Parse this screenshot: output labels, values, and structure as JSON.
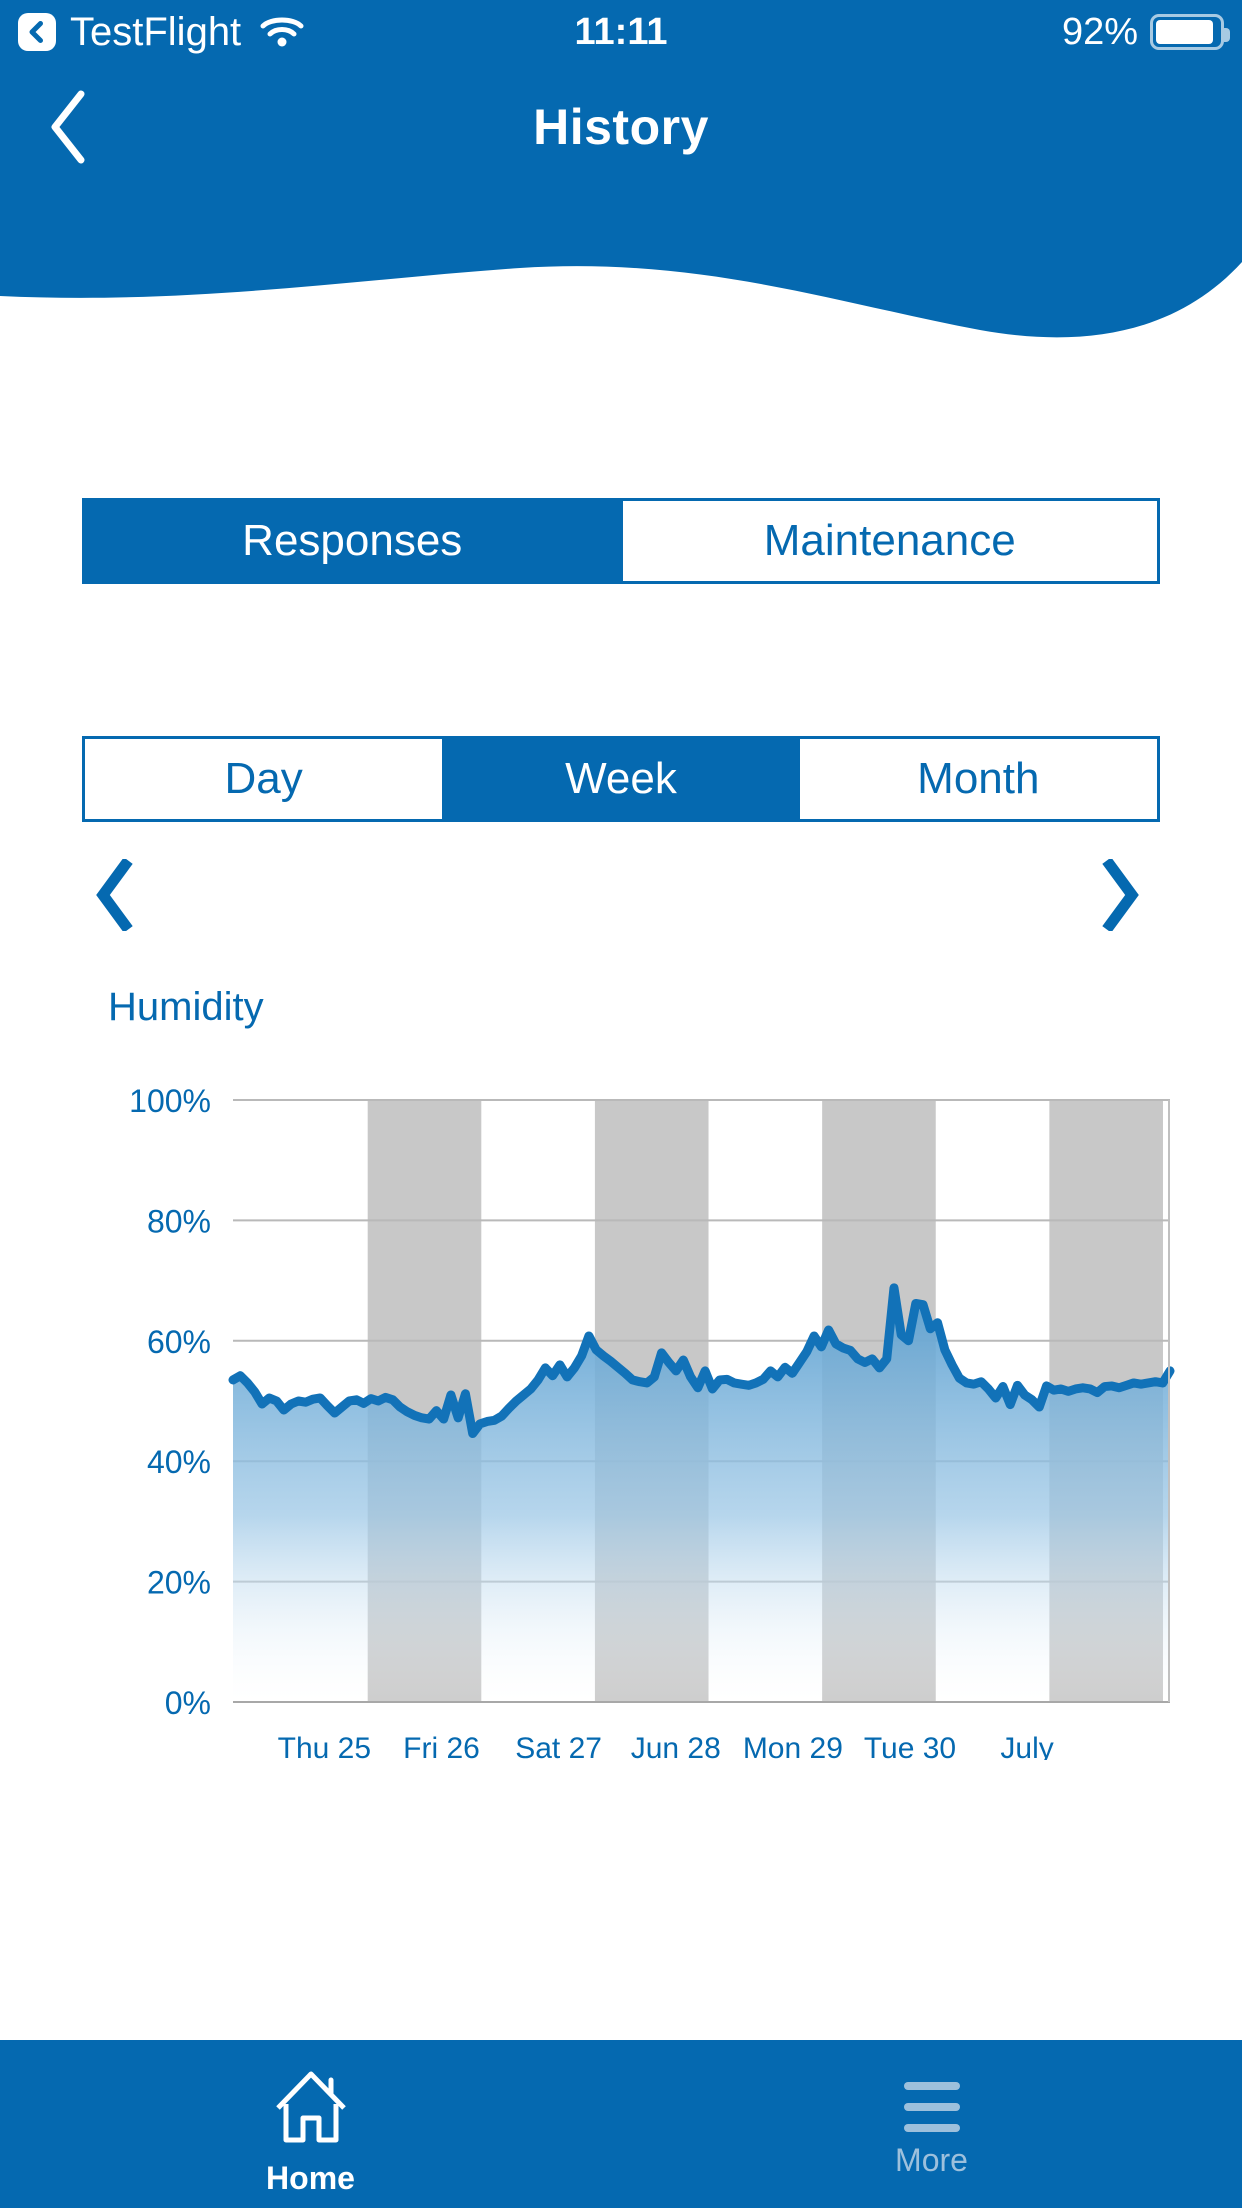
{
  "status_bar": {
    "back_badge_icon": "back-chevron-badge-icon",
    "carrier": "TestFlight",
    "wifi_icon": "wifi-icon",
    "time": "11:11",
    "battery_percent": "92%",
    "battery_level": 92,
    "battery_icon": "battery-icon"
  },
  "nav": {
    "back_icon": "chevron-left-icon",
    "title": "History"
  },
  "source_tabs": {
    "name": "responses-maintenance-segmented-control",
    "items": [
      {
        "label": "Responses",
        "active": true
      },
      {
        "label": "Maintenance",
        "active": false
      }
    ]
  },
  "range_tabs": {
    "name": "day-week-month-segmented-control",
    "items": [
      {
        "label": "Day",
        "active": false
      },
      {
        "label": "Week",
        "active": true
      },
      {
        "label": "Month",
        "active": false
      }
    ]
  },
  "pager": {
    "prev_icon": "chevron-left-icon",
    "next_icon": "chevron-right-icon"
  },
  "chart_data": {
    "type": "area",
    "title": "Humidity",
    "xlabel": "",
    "ylabel": "",
    "ylim": [
      0,
      100
    ],
    "grid": true,
    "legend": "none",
    "y_ticks": [
      "0%",
      "20%",
      "40%",
      "60%",
      "80%",
      "100%"
    ],
    "y_tick_values": [
      0,
      20,
      40,
      60,
      80,
      100
    ],
    "x_ticks": [
      "Thu 25",
      "Fri 26",
      "Sat 27",
      "Jun 28",
      "Mon 29",
      "Tue 30",
      "July"
    ],
    "shaded_bands": [
      {
        "start_index": 1,
        "end_index": 2
      },
      {
        "start_index": 3,
        "end_index": 4
      },
      {
        "start_index": 5,
        "end_index": 6
      },
      {
        "start_index": 7,
        "end_index": 8
      }
    ],
    "series": [
      {
        "name": "Humidity",
        "unit": "%",
        "line_color": "#1272b8",
        "fill_top_color": "#5a9fd0",
        "fill_bottom_color": "#ffffff",
        "values": [
          53.5,
          54.2,
          53.0,
          51.5,
          49.5,
          50.5,
          50.0,
          48.5,
          49.5,
          50.0,
          49.8,
          50.3,
          50.5,
          49.2,
          48.0,
          49.0,
          50.0,
          50.2,
          49.6,
          50.4,
          50.0,
          50.6,
          50.2,
          49.0,
          48.2,
          47.6,
          47.2,
          47.0,
          48.4,
          47.0,
          51.0,
          47.2,
          51.2,
          44.6,
          46.2,
          46.6,
          46.8,
          47.5,
          48.8,
          50.0,
          51.0,
          52.0,
          53.5,
          55.5,
          54.2,
          56.0,
          54.0,
          55.5,
          57.5,
          60.8,
          58.5,
          57.5,
          56.6,
          55.6,
          54.6,
          53.5,
          53.2,
          53.0,
          54.0,
          58.0,
          56.4,
          55.0,
          56.8,
          54.0,
          52.2,
          55.0,
          52.0,
          53.5,
          53.6,
          53.0,
          52.8,
          52.6,
          53.0,
          53.6,
          55.0,
          54.0,
          55.6,
          54.6,
          56.4,
          58.2,
          60.8,
          59.0,
          61.8,
          59.5,
          58.8,
          58.4,
          57.0,
          56.4,
          57.0,
          55.5,
          57.0,
          68.8,
          61.0,
          60.0,
          66.2,
          66.0,
          62.0,
          63.0,
          58.5,
          56.0,
          53.8,
          53.0,
          52.8,
          53.2,
          52.0,
          50.5,
          52.4,
          49.4,
          52.6,
          51.0,
          50.2,
          49.0,
          52.5,
          51.8,
          52.0,
          51.6,
          52.0,
          52.2,
          52.0,
          51.4,
          52.4,
          52.5,
          52.2,
          52.6,
          53.0,
          52.8,
          53.0,
          53.2,
          53.0,
          55.0
        ]
      }
    ]
  },
  "tabbar": {
    "items": [
      {
        "label": "Home",
        "icon": "home-icon",
        "active": true
      },
      {
        "label": "More",
        "icon": "hamburger-menu-icon",
        "active": false
      }
    ]
  },
  "colors": {
    "brand_blue": "#0569b0",
    "line_blue": "#1272b8",
    "band_gray": "#c8c8c8",
    "inactive_tab": "#9dc0dc"
  }
}
